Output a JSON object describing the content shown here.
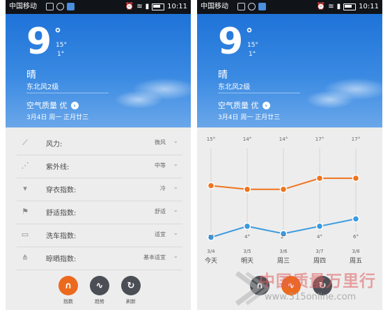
{
  "status_bar": {
    "carrier": "中国移动",
    "time": "10:11"
  },
  "weather": {
    "temp": "9",
    "deg": "°",
    "high": "15°",
    "low": "1°",
    "condition": "晴",
    "wind": "东北风2级",
    "air_quality": "空气质量 优",
    "date": "3月4日 周一 正月廿三"
  },
  "indices": [
    {
      "label": "风力:",
      "value": "微风",
      "icon": "wind-icon"
    },
    {
      "label": "紫外线:",
      "value": "中等",
      "icon": "uv-icon"
    },
    {
      "label": "穿衣指数:",
      "value": "冷",
      "icon": "clothing-icon"
    },
    {
      "label": "舒适指数:",
      "value": "舒适",
      "icon": "comfort-flag-icon"
    },
    {
      "label": "洗车指数:",
      "value": "适宜",
      "icon": "car-icon"
    },
    {
      "label": "晾晒指数:",
      "value": "基本适宜",
      "icon": "drying-icon"
    }
  ],
  "buttons": {
    "index": "指数",
    "trend": "趋势",
    "refresh": "刷新"
  },
  "chart_data": {
    "type": "line",
    "categories": [
      "今天",
      "明天",
      "周三",
      "周四",
      "周五"
    ],
    "dates": [
      "3/4",
      "3/5",
      "3/6",
      "3/7",
      "3/8"
    ],
    "series": [
      {
        "values": [
          15,
          14,
          14,
          17,
          17
        ],
        "color": "#f0741e"
      },
      {
        "values": [
          1,
          4,
          2,
          4,
          6
        ],
        "color": "#3a9ae0"
      }
    ],
    "high_labels": [
      "15°",
      "14°",
      "14°",
      "17°",
      "17°"
    ],
    "low_labels": [
      "1°",
      "4°",
      "2°",
      "4°",
      "6°"
    ],
    "grid": true
  },
  "watermark": {
    "text": "中国质量万里行",
    "url": "www.315online.com"
  },
  "colors": {
    "accent": "#ec6a1d",
    "sky": "#2a7bdc",
    "inactive_button": "#4b4f55"
  }
}
